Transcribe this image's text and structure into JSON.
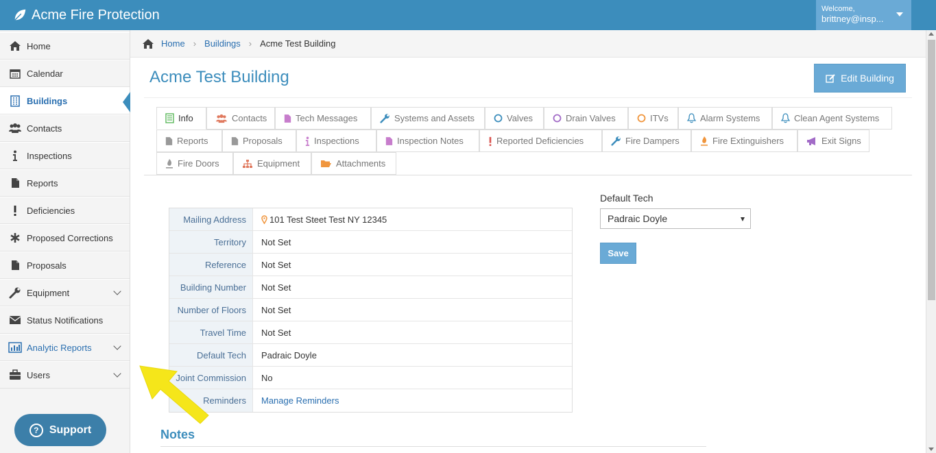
{
  "app": {
    "title": "Acme Fire Protection"
  },
  "user": {
    "welcome": "Welcome,",
    "name": "brittney@insp..."
  },
  "sidebar": {
    "items": [
      {
        "label": "Home",
        "icon": "home-icon"
      },
      {
        "label": "Calendar",
        "icon": "calendar-icon"
      },
      {
        "label": "Buildings",
        "icon": "building-icon"
      },
      {
        "label": "Contacts",
        "icon": "users-icon"
      },
      {
        "label": "Inspections",
        "icon": "info-icon"
      },
      {
        "label": "Reports",
        "icon": "file-icon"
      },
      {
        "label": "Deficiencies",
        "icon": "exclamation-icon"
      },
      {
        "label": "Proposed Corrections",
        "icon": "asterisk-icon"
      },
      {
        "label": "Proposals",
        "icon": "file-icon"
      },
      {
        "label": "Equipment",
        "icon": "wrench-icon"
      },
      {
        "label": "Status Notifications",
        "icon": "envelope-icon"
      },
      {
        "label": "Analytic Reports",
        "icon": "bar-chart-icon"
      },
      {
        "label": "Users",
        "icon": "briefcase-icon"
      }
    ],
    "active": "Buildings",
    "support_label": "Support"
  },
  "breadcrumb": {
    "home": "Home",
    "buildings": "Buildings",
    "current": "Acme Test Building"
  },
  "page": {
    "title": "Acme Test Building",
    "edit_label": "Edit Building"
  },
  "tabs": [
    {
      "label": "Info",
      "icon": "list-icon",
      "color": "#5cb85c"
    },
    {
      "label": "Contacts",
      "icon": "users-icon",
      "color": "#e07a5f"
    },
    {
      "label": "Tech Messages",
      "icon": "file-icon",
      "color": "#c77dcc"
    },
    {
      "label": "Systems and Assets",
      "icon": "wrench-icon",
      "color": "#3c8dbc"
    },
    {
      "label": "Valves",
      "icon": "circle-icon",
      "color": "#3c8dbc"
    },
    {
      "label": "Drain Valves",
      "icon": "circle-icon",
      "color": "#a26bc7"
    },
    {
      "label": "ITVs",
      "icon": "circle-icon",
      "color": "#f0953c"
    },
    {
      "label": "Alarm Systems",
      "icon": "bell-icon",
      "color": "#3c8dbc"
    },
    {
      "label": "Clean Agent Systems",
      "icon": "bell-icon",
      "color": "#3c8dbc"
    },
    {
      "label": "Reports",
      "icon": "file-icon",
      "color": "#999999"
    },
    {
      "label": "Proposals",
      "icon": "file-icon",
      "color": "#999999"
    },
    {
      "label": "Inspections",
      "icon": "info-icon",
      "color": "#c77dcc"
    },
    {
      "label": "Inspection Notes",
      "icon": "file-icon",
      "color": "#c77dcc"
    },
    {
      "label": "Reported Deficiencies",
      "icon": "exclamation-icon",
      "color": "#d9534f"
    },
    {
      "label": "Fire Dampers",
      "icon": "wrench-icon",
      "color": "#3c8dbc"
    },
    {
      "label": "Fire Extinguishers",
      "icon": "extinguisher-icon",
      "color": "#f0953c"
    },
    {
      "label": "Exit Signs",
      "icon": "bullhorn-icon",
      "color": "#a26bc7"
    },
    {
      "label": "Fire Doors",
      "icon": "extinguisher-icon",
      "color": "#999999"
    },
    {
      "label": "Equipment",
      "icon": "sitemap-icon",
      "color": "#e07a5f"
    },
    {
      "label": "Attachments",
      "icon": "folder-open-icon",
      "color": "#f0953c"
    }
  ],
  "info": [
    {
      "label": "Mailing Address",
      "value": "101 Test Steet Test NY 12345"
    },
    {
      "label": "Territory",
      "value": "Not Set"
    },
    {
      "label": "Reference",
      "value": "Not Set"
    },
    {
      "label": "Building Number",
      "value": "Not Set"
    },
    {
      "label": "Number of Floors",
      "value": "Not Set"
    },
    {
      "label": "Travel Time",
      "value": "Not Set"
    },
    {
      "label": "Default Tech",
      "value": "Padraic Doyle"
    },
    {
      "label": "Joint Commission",
      "value": "No"
    },
    {
      "label": "Reminders",
      "value": "Manage Reminders"
    }
  ],
  "default_tech": {
    "label": "Default Tech",
    "selected": "Padraic Doyle",
    "save_label": "Save"
  },
  "notes": {
    "title": "Notes"
  },
  "colors": {
    "header": "#3c8dbc",
    "accent_button": "#6aaad6",
    "arrow": "#f5e61a"
  }
}
